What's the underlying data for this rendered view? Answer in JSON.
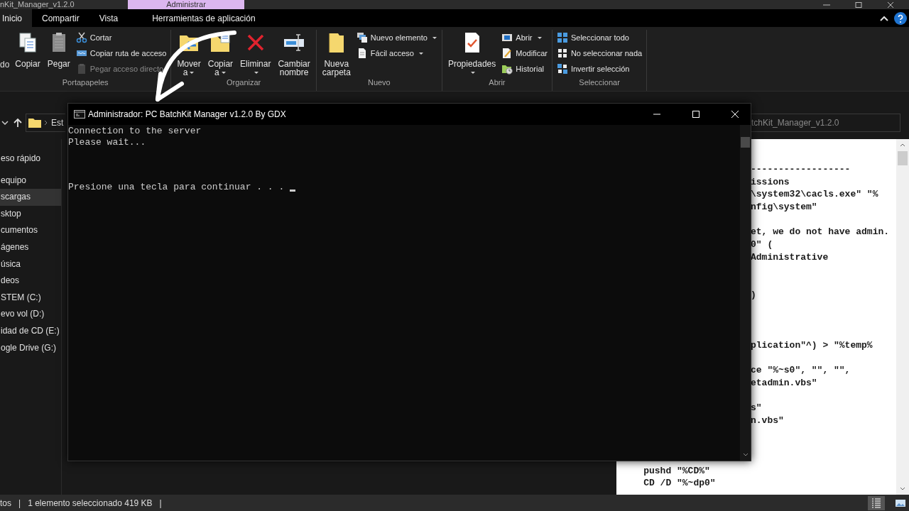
{
  "explorer": {
    "title": "nKit_Manager_v1.2.0",
    "context_tab": "Administrar",
    "tabs": [
      {
        "label": "Inicio",
        "selected": true
      },
      {
        "label": "Compartir",
        "selected": false
      },
      {
        "label": "Vista",
        "selected": false
      },
      {
        "label": "Herramientas de aplicación",
        "selected": false
      }
    ],
    "ribbon": [
      {
        "label": "Portapapeles",
        "items": [
          {
            "kind": "partial",
            "label": "do"
          },
          {
            "kind": "large",
            "label": "Copiar",
            "has_menu": false
          },
          {
            "kind": "large",
            "label": "Pegar",
            "has_menu": false
          },
          {
            "kind": "stack",
            "items": [
              {
                "label": "Cortar",
                "disabled": false,
                "has_menu": false
              },
              {
                "label": "Copiar ruta de acceso",
                "disabled": false,
                "has_menu": false
              },
              {
                "label": "Pegar acceso directo",
                "disabled": true,
                "has_menu": false
              }
            ]
          }
        ]
      },
      {
        "label": "Organizar",
        "items": [
          {
            "kind": "large",
            "label": "Mover a",
            "has_menu": true
          },
          {
            "kind": "large",
            "label": "Copiar a",
            "has_menu": true
          },
          {
            "kind": "large",
            "label": "Eliminar",
            "has_menu": true
          },
          {
            "kind": "large",
            "label": "Cambiar nombre",
            "has_menu": false
          }
        ]
      },
      {
        "label": "Nuevo",
        "items": [
          {
            "kind": "large",
            "label": "Nueva carpeta",
            "has_menu": false
          },
          {
            "kind": "stack",
            "items": [
              {
                "label": "Nuevo elemento",
                "disabled": false,
                "has_menu": true
              },
              {
                "label": "Fácil acceso",
                "disabled": false,
                "has_menu": true
              }
            ]
          }
        ]
      },
      {
        "label": "Abrir",
        "items": [
          {
            "kind": "large",
            "label": "Propiedades",
            "has_menu": true
          },
          {
            "kind": "stack",
            "items": [
              {
                "label": "Abrir",
                "disabled": false,
                "has_menu": true
              },
              {
                "label": "Modificar",
                "disabled": false,
                "has_menu": false
              },
              {
                "label": "Historial",
                "disabled": false,
                "has_menu": false
              }
            ]
          }
        ]
      },
      {
        "label": "Seleccionar",
        "items": [
          {
            "kind": "stack",
            "items": [
              {
                "label": "Seleccionar todo",
                "disabled": false,
                "has_menu": false
              },
              {
                "label": "No seleccionar nada",
                "disabled": false,
                "has_menu": false
              },
              {
                "label": "Invertir selección",
                "disabled": false,
                "has_menu": false
              }
            ]
          }
        ]
      }
    ],
    "address": {
      "segment": "Est"
    },
    "search": {
      "placeholder": "tchKit_Manager_v1.2.0"
    },
    "nav": [
      {
        "label": "eso rápido",
        "selected": false
      },
      {
        "label": "equipo",
        "selected": false,
        "children": [
          {
            "label": "scargas",
            "selected": true
          },
          {
            "label": "sktop",
            "selected": false
          },
          {
            "label": "cumentos",
            "selected": false
          },
          {
            "label": "ágenes",
            "selected": false
          },
          {
            "label": "úsica",
            "selected": false
          },
          {
            "label": "deos",
            "selected": false
          },
          {
            "label": "STEM (C:)",
            "selected": false
          },
          {
            "label": "evo vol (D:)",
            "selected": false
          },
          {
            "label": "idad de CD (E:)",
            "selected": false
          },
          {
            "label": "ogle Drive (G:)",
            "selected": false
          }
        ]
      }
    ],
    "preview_lines": [
      {
        "kind": "partial",
        "text": "------------------"
      },
      {
        "kind": "partial",
        "text": "issions"
      },
      {
        "kind": "partial",
        "text": "\\system32\\cacls.exe\" \"%"
      },
      {
        "kind": "partial",
        "text": "nfig\\system\""
      },
      {
        "kind": "covered"
      },
      {
        "kind": "partial",
        "text": "et, we do not have admin."
      },
      {
        "kind": "partial",
        "text": "0\" ("
      },
      {
        "kind": "partial",
        "text": "Administrative"
      },
      {
        "kind": "covered"
      },
      {
        "kind": "covered"
      },
      {
        "kind": "partial",
        "text": ")"
      },
      {
        "kind": "covered"
      },
      {
        "kind": "covered"
      },
      {
        "kind": "covered"
      },
      {
        "kind": "partial",
        "text": "plication\"^) > \"%temp%"
      },
      {
        "kind": "covered"
      },
      {
        "kind": "partial",
        "text": "ce \"%~s0\", \"\", \"\","
      },
      {
        "kind": "partial",
        "text": "etadmin.vbs\""
      },
      {
        "kind": "covered"
      },
      {
        "kind": "partial",
        "text": "s\""
      },
      {
        "kind": "partial",
        "text": "n.vbs\""
      },
      {
        "kind": "covered"
      },
      {
        "kind": "covered"
      },
      {
        "kind": "covered"
      },
      {
        "kind": "full",
        "text": "    pushd \"%CD%\""
      },
      {
        "kind": "full",
        "text": "    CD /D \"%~dp0\""
      }
    ],
    "status_bar": {
      "items": [
        "tos",
        "|",
        "1 elemento seleccionado  419 KB",
        "|"
      ],
      "views": [
        {
          "kind": "details",
          "selected": true
        },
        {
          "kind": "tiles",
          "selected": false
        }
      ]
    }
  },
  "console": {
    "title": "Administrador:  PC BatchKit Manager v1.2.0 By GDX",
    "lines": [
      {
        "kind": "text",
        "text": "Connection to the server"
      },
      {
        "kind": "text",
        "text": "Please wait..."
      },
      {
        "kind": "blank"
      },
      {
        "kind": "blank"
      },
      {
        "kind": "blank"
      },
      {
        "kind": "text",
        "text": "Presione una tecla para continuar . . . "
      }
    ],
    "cursor": true
  }
}
